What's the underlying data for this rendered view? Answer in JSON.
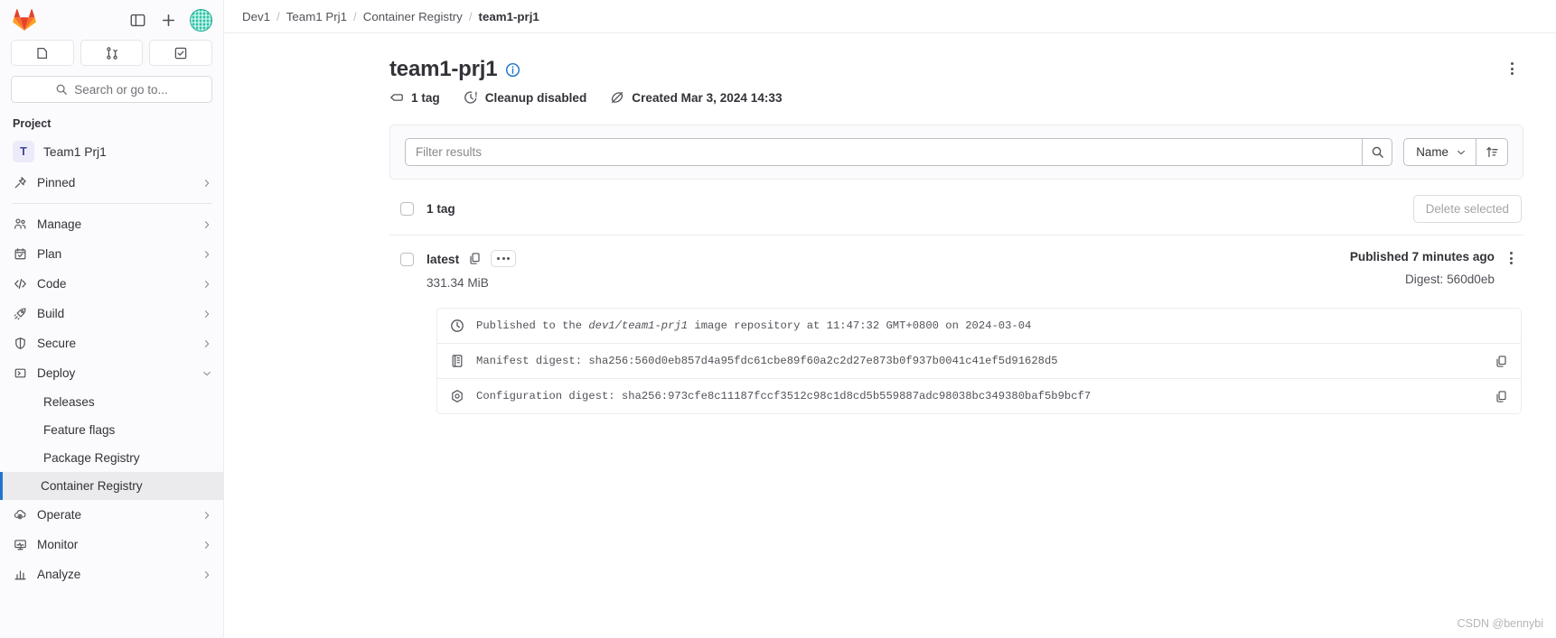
{
  "sidebar": {
    "logo": "gitlab-logo",
    "top_icons": [
      {
        "name": "sidebar-toggle-icon"
      },
      {
        "name": "create-new-icon"
      },
      {
        "name": "user-avatar"
      }
    ],
    "quick_actions": [
      {
        "name": "issues-icon"
      },
      {
        "name": "merge-requests-icon"
      },
      {
        "name": "todos-icon"
      }
    ],
    "search_placeholder": "Search or go to...",
    "section_label": "Project",
    "project": {
      "initial": "T",
      "name": "Team1 Prj1"
    },
    "items": [
      {
        "label": "Pinned",
        "icon": "pin-icon",
        "expandable": true
      },
      {
        "label": "Manage",
        "icon": "users-icon",
        "expandable": true
      },
      {
        "label": "Plan",
        "icon": "calendar-icon",
        "expandable": true
      },
      {
        "label": "Code",
        "icon": "code-icon",
        "expandable": true
      },
      {
        "label": "Build",
        "icon": "rocket-icon",
        "expandable": true
      },
      {
        "label": "Secure",
        "icon": "shield-icon",
        "expandable": true
      },
      {
        "label": "Deploy",
        "icon": "deploy-icon",
        "expandable": true,
        "expanded": true
      },
      {
        "label": "Operate",
        "icon": "cloud-gear-icon",
        "expandable": true
      },
      {
        "label": "Monitor",
        "icon": "monitor-icon",
        "expandable": true
      },
      {
        "label": "Analyze",
        "icon": "chart-icon",
        "expandable": true
      }
    ],
    "deploy_children": [
      {
        "label": "Releases",
        "active": false
      },
      {
        "label": "Feature flags",
        "active": false
      },
      {
        "label": "Package Registry",
        "active": false
      },
      {
        "label": "Container Registry",
        "active": true
      }
    ]
  },
  "breadcrumb": {
    "items": [
      "Dev1",
      "Team1 Prj1",
      "Container Registry"
    ],
    "current": "team1-prj1",
    "separator": "/"
  },
  "header": {
    "title": "team1-prj1",
    "info_icon": "info-icon",
    "meta": [
      {
        "label": "1 tag",
        "icon": "tag-icon"
      },
      {
        "label": "Cleanup disabled",
        "icon": "clock-warning-icon"
      },
      {
        "label": "Created Mar 3, 2024 14:33",
        "icon": "eye-slash-icon"
      }
    ],
    "more_actions_icon": "kebab-menu-icon"
  },
  "filter": {
    "placeholder": "Filter results",
    "value": "",
    "search_icon": "search-icon",
    "sort_field": "Name",
    "sort_chevron": "chevron-down-icon",
    "sort_direction_icon": "sort-ascending-icon"
  },
  "list": {
    "select_all_label": "1 tag",
    "delete_selected_label": "Delete selected",
    "delete_enabled": false
  },
  "tag": {
    "name": "latest",
    "copy_icon": "copy-icon",
    "more_badge_icon": "ellipsis-badge",
    "size": "331.34 MiB",
    "published": "Published 7 minutes ago",
    "digest_short": "Digest: 560d0eb",
    "row_menu_icon": "kebab-menu-icon",
    "details": [
      {
        "icon": "clock-icon",
        "prefix": "Published to the ",
        "repo": "dev1/team1-prj1",
        "suffix": " image repository at 11:47:32 GMT+0800 on 2024-03-04",
        "copyable": false
      },
      {
        "icon": "manifest-icon",
        "text": "Manifest digest: sha256:560d0eb857d4a95fdc61cbe89f60a2c2d27e873b0f937b0041c41ef5d91628d5",
        "copyable": true
      },
      {
        "icon": "configuration-icon",
        "text": "Configuration digest: sha256:973cfe8c11187fccf3512c98c1d8cd5b559887adc98038bc349380baf5b9bcf7",
        "copyable": true
      }
    ]
  },
  "watermark": "CSDN @bennybi",
  "colors": {
    "accent": "#1f75cb",
    "sidebar_bg": "#fbfafd",
    "text": "#333238",
    "muted": "#535158"
  }
}
